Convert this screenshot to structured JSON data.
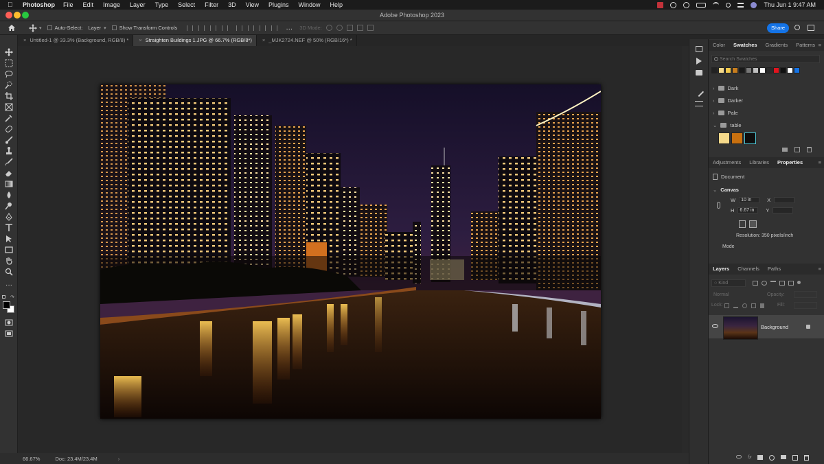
{
  "mac_menubar": {
    "app_name": "Photoshop",
    "menus": [
      "File",
      "Edit",
      "Image",
      "Layer",
      "Type",
      "Select",
      "Filter",
      "3D",
      "View",
      "Plugins",
      "Window",
      "Help"
    ],
    "clock": "Thu Jun 1  9:47 AM"
  },
  "window": {
    "title": "Adobe Photoshop 2023"
  },
  "options_bar": {
    "auto_select_label": "Auto-Select:",
    "auto_select_value": "Layer",
    "transform_label": "Show Transform Controls",
    "mode_3d_label": "3D Mode:",
    "share_label": "Share"
  },
  "doc_tabs": [
    {
      "label": "Untitled-1 @ 33.3% (Background, RGB/8) *",
      "active": false
    },
    {
      "label": "Straighten Buildings 1.JPG @ 66.7% (RGB/8*)",
      "active": true
    },
    {
      "label": "_MJK2724.NEF @ 50% (RGB/16*) *",
      "active": false
    }
  ],
  "status_bar": {
    "zoom": "66.67%",
    "doc": "Doc: 23.4M/23.4M"
  },
  "swatches_panel": {
    "tabs": [
      "Color",
      "Swatches",
      "Gradients",
      "Patterns"
    ],
    "active_tab": "Swatches",
    "search_placeholder": "Search Swatches",
    "recent_colors": [
      "#222222",
      "#f5d98a",
      "#f2c94c",
      "#c77d1e",
      "#1a1a1a",
      "#777777",
      "#bfbfbf",
      "#ffffff",
      "#2b2b2b",
      "#e0141e",
      "#111111",
      "#ffffff",
      "#1473e6"
    ],
    "groups": [
      "Dark",
      "Darker",
      "Pale",
      "table"
    ],
    "table_colors": [
      "#f5d98a",
      "#c8700f",
      "#0e0e0e"
    ]
  },
  "properties_panel": {
    "tabs": [
      "Adjustments",
      "Libraries",
      "Properties"
    ],
    "active_tab": "Properties",
    "doc_label": "Document",
    "section": "Canvas",
    "w_label": "W",
    "w_value": "10 in",
    "h_label": "H",
    "h_value": "6.67 in",
    "x_label": "X",
    "y_label": "Y",
    "resolution": "Resolution: 350 pixels/inch",
    "mode_label": "Mode"
  },
  "layers_panel": {
    "tabs": [
      "Layers",
      "Channels",
      "Paths"
    ],
    "active_tab": "Layers",
    "kind_placeholder": "Kind",
    "blend_mode": "Normal",
    "opacity_label": "Opacity:",
    "lock_label": "Lock:",
    "fill_label": "Fill:",
    "layers": [
      {
        "name": "Background",
        "locked": true,
        "visible": true
      }
    ]
  }
}
